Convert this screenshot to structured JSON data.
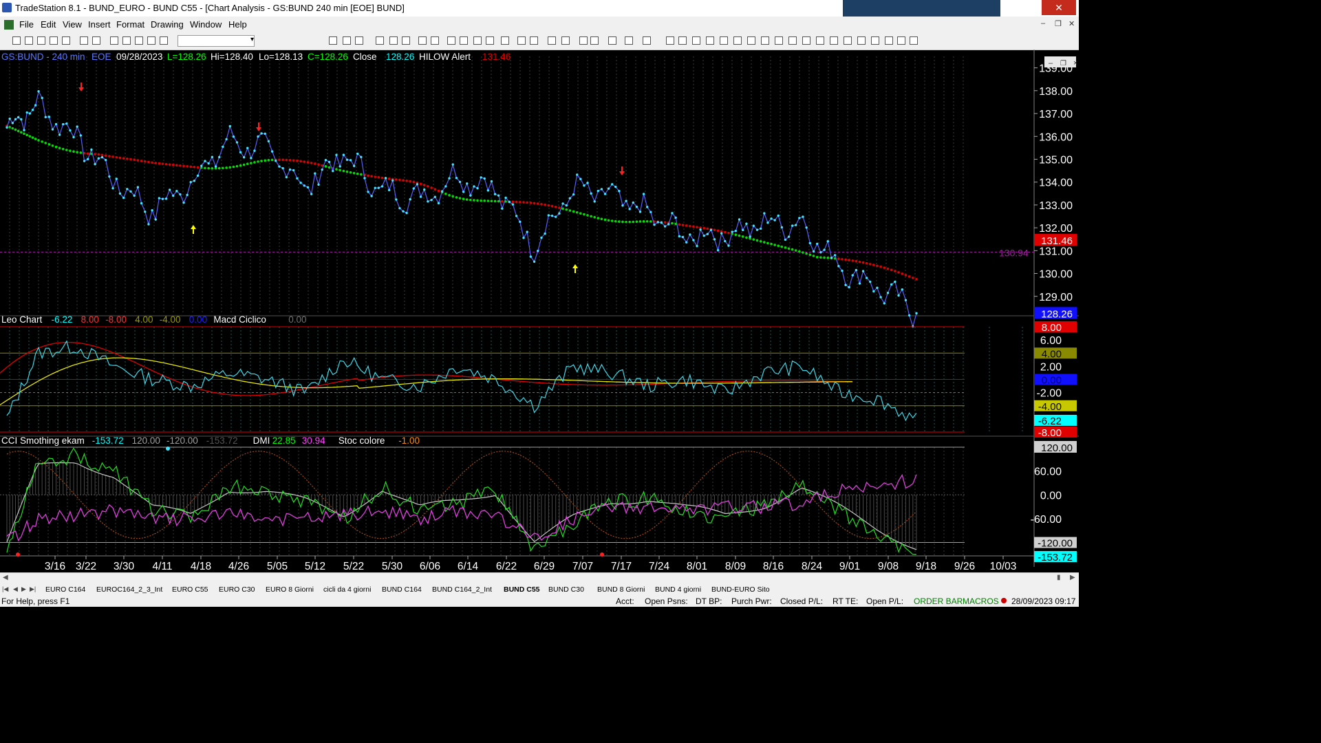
{
  "window": {
    "title": "TradeStation 8.1 - BUND_EURO - BUND C55 - [Chart Analysis - GS:BUND  240 min  [EOE] BUND]"
  },
  "menu": [
    "File",
    "Edit",
    "View",
    "Insert",
    "Format",
    "Drawing",
    "Window",
    "Help"
  ],
  "status_line": {
    "symbol": "GS:BUND - 240 min",
    "session": "EOE",
    "date": "09/28/2023",
    "last": "L=128.26",
    "high": "Hi=128.40",
    "low": "Lo=128.13",
    "close": "C=128.26",
    "close_label": "Close",
    "close_value": "128.26",
    "alert_label": "HILOW Alert",
    "alert_value": "131.46"
  },
  "price_pane": {
    "y_ticks": [
      139,
      138,
      137,
      136,
      135,
      134,
      133,
      132,
      131,
      130,
      129
    ],
    "y_tick_labels": [
      "139.00",
      "138.00",
      "137.00",
      "136.00",
      "135.00",
      "134.00",
      "133.00",
      "132.00",
      "131.00",
      "130.00",
      "129.00"
    ],
    "ref_label": "130.94",
    "ref_value": 130.94,
    "badge_alert": "131.46",
    "badge_last": "128.26"
  },
  "osc_pane": {
    "legend": [
      {
        "text": "Leo Chart",
        "color": "#ffffff"
      },
      {
        "text": "-6.22",
        "color": "#00ffff"
      },
      {
        "text": "8.00",
        "color": "#ff3030"
      },
      {
        "text": "-8.00",
        "color": "#ff3030"
      },
      {
        "text": "4.00",
        "color": "#9a9a00"
      },
      {
        "text": "-4.00",
        "color": "#9a9a00"
      },
      {
        "text": "0.00",
        "color": "#2020ff"
      },
      {
        "text": "Macd Ciclico",
        "color": "#ffffff"
      },
      {
        "text": "0.00",
        "color": "#707070"
      }
    ],
    "y_ticks": [
      6,
      2,
      -2
    ],
    "y_tick_labels": [
      "6.00",
      "2.00",
      "-2.00"
    ],
    "badges": [
      {
        "value": 8,
        "text": "8.00",
        "bg": "#e00000",
        "fg": "#ffffff"
      },
      {
        "value": 4,
        "text": "4.00",
        "bg": "#8a8a00",
        "fg": "#000000"
      },
      {
        "value": 0,
        "text": "0.00",
        "bg": "#1010ff",
        "fg": "#000080"
      },
      {
        "value": -4,
        "text": "-4.00",
        "bg": "#c8c800",
        "fg": "#000000"
      },
      {
        "value": -6.22,
        "text": "-6.22",
        "bg": "#00ffff",
        "fg": "#000000"
      },
      {
        "value": -8,
        "text": "-8.00",
        "bg": "#e00000",
        "fg": "#ffffff"
      }
    ]
  },
  "cci_pane": {
    "legend": [
      {
        "text": "CCI Smothing ekam",
        "color": "#ffffff"
      },
      {
        "text": "-153.72",
        "color": "#00ffff"
      },
      {
        "text": "120.00",
        "color": "#a0a0a0"
      },
      {
        "text": "-120.00",
        "color": "#a0a0a0"
      },
      {
        "text": "-153.72",
        "color": "#555555"
      },
      {
        "text": "DMI",
        "color": "#ffffff"
      },
      {
        "text": "22.85",
        "color": "#00ff00"
      },
      {
        "text": "30.94",
        "color": "#ff40ff"
      },
      {
        "text": "Stoc colore",
        "color": "#ffffff"
      },
      {
        "text": "-1.00",
        "color": "#ff8c00"
      }
    ],
    "y_ticks": [
      60,
      0,
      -60
    ],
    "y_tick_labels": [
      "60.00",
      "0.00",
      "-60.00"
    ],
    "badge_top": "120.00",
    "badge_120n": "-120.00",
    "badge_last": "-153.72"
  },
  "x_axis": {
    "labels": [
      "3/16",
      "3/22",
      "3/30",
      "4/11",
      "4/18",
      "4/26",
      "5/05",
      "5/12",
      "5/22",
      "5/30",
      "6/06",
      "6/14",
      "6/22",
      "6/29",
      "7/07",
      "7/17",
      "7/24",
      "8/01",
      "8/09",
      "8/16",
      "8/24",
      "9/01",
      "9/08",
      "9/18",
      "9/26",
      "10/03"
    ]
  },
  "chart_data": [
    {
      "type": "line",
      "title": "GS:BUND - 240 min",
      "x": [
        "3/16",
        "3/22",
        "3/30",
        "4/11",
        "4/18",
        "4/26",
        "5/05",
        "5/12",
        "5/22",
        "5/30",
        "6/06",
        "6/14",
        "6/22",
        "6/29",
        "7/07",
        "7/17",
        "7/24",
        "8/01",
        "8/09",
        "8/16",
        "8/24",
        "9/01",
        "9/08",
        "9/18",
        "9/26"
      ],
      "series": [
        {
          "name": "Close",
          "values": [
            136.4,
            137.4,
            136.0,
            134.1,
            132.7,
            134.0,
            135.8,
            135.4,
            133.8,
            135.2,
            133.6,
            133.3,
            134.3,
            133.7,
            131.2,
            133.7,
            133.4,
            132.6,
            131.6,
            131.7,
            132.2,
            132.2,
            130.3,
            129.4,
            128.3
          ]
        }
      ],
      "ylim": [
        128.3,
        139.5
      ],
      "reference_lines": [
        130.94
      ]
    },
    {
      "type": "line",
      "title": "Leo Chart / Macd Ciclico",
      "series": [
        {
          "name": "Leo Chart",
          "values": [
            -6,
            4,
            5,
            2,
            0,
            -1,
            1,
            0,
            -2,
            3,
            0,
            -1,
            2,
            0,
            -4,
            2,
            1,
            -1,
            0,
            -2,
            1,
            2,
            -2,
            -3,
            -6.22
          ]
        }
      ],
      "ylim": [
        -8,
        8
      ],
      "levels": [
        8,
        4,
        0,
        -4,
        -8
      ]
    },
    {
      "type": "line",
      "title": "CCI Smothing ekam / DMI / Stoc colore",
      "series": [
        {
          "name": "CCI Smothing ekam",
          "values": [
            -140,
            80,
            100,
            60,
            -40,
            -60,
            20,
            10,
            -20,
            -60,
            20,
            -40,
            -20,
            10,
            -140,
            -70,
            -20,
            -10,
            -40,
            -60,
            -30,
            20,
            -40,
            -100,
            -153.72
          ]
        },
        {
          "name": "DMI",
          "values": [
            -120,
            -60,
            -50,
            -40,
            -60,
            -60,
            -50,
            -60,
            -60,
            -50,
            -40,
            -60,
            -40,
            -50,
            -110,
            -60,
            -30,
            -30,
            -40,
            -30,
            -30,
            -20,
            10,
            20,
            40
          ]
        }
      ],
      "ylim": [
        -153.72,
        120
      ],
      "levels": [
        120,
        0,
        -120
      ]
    }
  ],
  "tabs": [
    "EURO C164",
    "EUROC164_2_3_Int",
    "EURO C55",
    "EURO C30",
    "EURO 8 Giorni",
    "cicli da 4 giorni",
    "BUND C164",
    "BUND C164_2_Int",
    "BUND C55",
    "BUND  C30",
    "BUND 8 Giorni",
    "BUND 4 giorni",
    "BUND-EURO Sito"
  ],
  "active_tab": "BUND C55",
  "statusbar": {
    "help": "For Help, press F1",
    "acct": "Acct:",
    "open_psns": "Open Psns:",
    "dt_bp": "DT BP:",
    "purch_pwr": "Purch Pwr:",
    "closed_pl": "Closed P/L:",
    "rt_te": "RT TE:",
    "open_pl": "Open P/L:",
    "order_bar": "ORDER BAR",
    "macros": "MACROS",
    "datetime": "28/09/2023 09:17"
  }
}
